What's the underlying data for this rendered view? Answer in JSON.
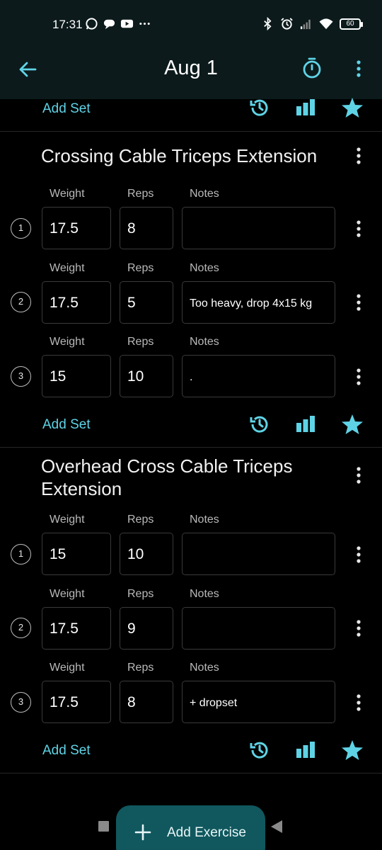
{
  "status_bar": {
    "time": "17:31",
    "battery": "60"
  },
  "app_bar": {
    "title": "Aug 1"
  },
  "previous_exercise": {
    "add_set_label": "Add Set"
  },
  "exercises": [
    {
      "title": "Crossing Cable Triceps Extension",
      "column_labels": {
        "weight": "Weight",
        "reps": "Reps",
        "notes": "Notes"
      },
      "sets": [
        {
          "number": "1",
          "weight": "17.5",
          "reps": "8",
          "notes": ""
        },
        {
          "number": "2",
          "weight": "17.5",
          "reps": "5",
          "notes": "Too heavy, drop 4x15 kg"
        },
        {
          "number": "3",
          "weight": "15",
          "reps": "10",
          "notes": "."
        }
      ],
      "add_set_label": "Add Set"
    },
    {
      "title": "Overhead Cross Cable Triceps Extension",
      "column_labels": {
        "weight": "Weight",
        "reps": "Reps",
        "notes": "Notes"
      },
      "sets": [
        {
          "number": "1",
          "weight": "15",
          "reps": "10",
          "notes": ""
        },
        {
          "number": "2",
          "weight": "17.5",
          "reps": "9",
          "notes": ""
        },
        {
          "number": "3",
          "weight": "17.5",
          "reps": "8",
          "notes": "+ dropset"
        }
      ],
      "add_set_label": "Add Set"
    }
  ],
  "fab": {
    "label": "Add Exercise"
  },
  "icons": {
    "back": "arrow-left-icon",
    "timer": "stopwatch-icon",
    "more": "more-vert-icon",
    "history": "history-icon",
    "stats": "bar-chart-icon",
    "favorite": "star-icon",
    "add": "plus-icon"
  },
  "colors": {
    "accent": "#5fd3e6",
    "app_bar": "#0c1a1b",
    "fab": "#10585e",
    "background": "#000000"
  }
}
